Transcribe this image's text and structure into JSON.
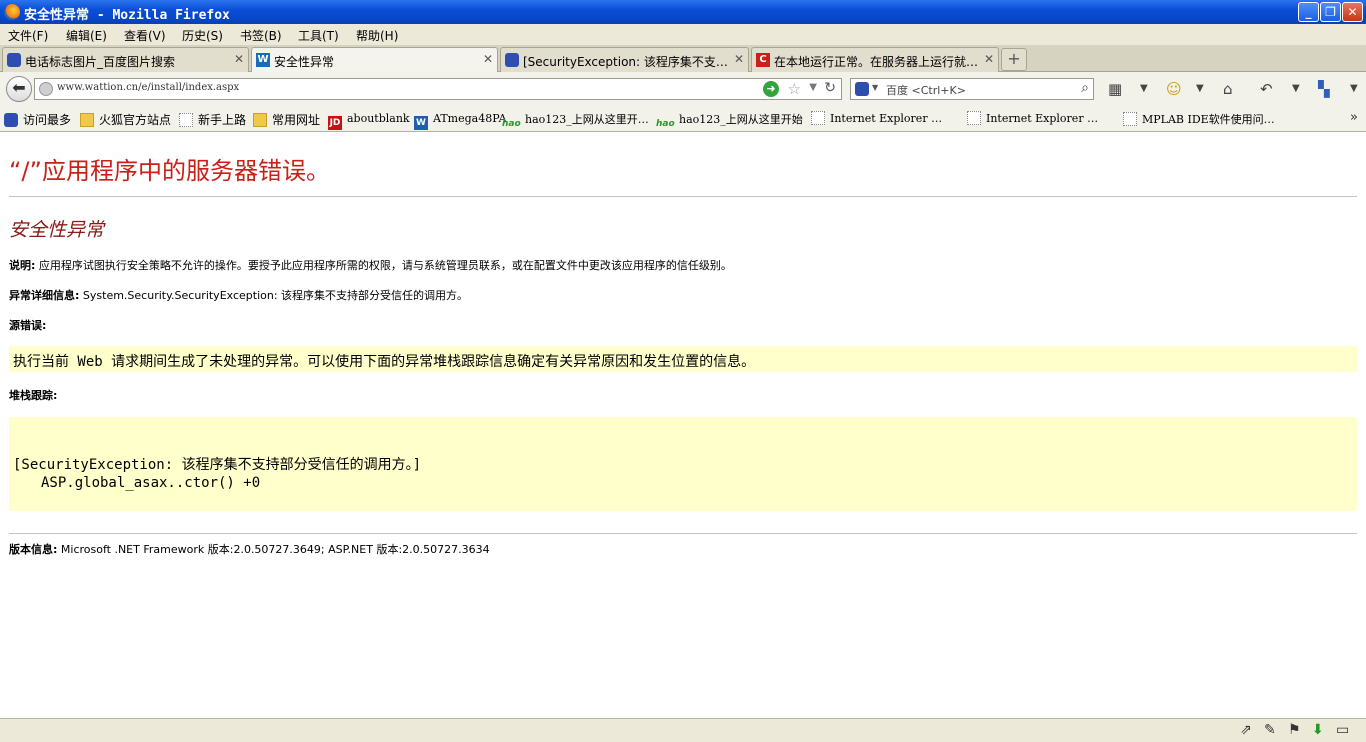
{
  "window": {
    "title": "安全性异常 - Mozilla Firefox",
    "minimize": "_",
    "restore": "❐",
    "close": "✕"
  },
  "menu": [
    {
      "label": "文件(F)"
    },
    {
      "label": "编辑(E)"
    },
    {
      "label": "查看(V)"
    },
    {
      "label": "历史(S)"
    },
    {
      "label": "书签(B)"
    },
    {
      "label": "工具(T)"
    },
    {
      "label": "帮助(H)"
    }
  ],
  "tabs": [
    {
      "label": "电话标志图片_百度图片搜索",
      "icon": "baidu-paw-icon",
      "active": false
    },
    {
      "label": "安全性异常",
      "icon": "w-site-icon",
      "active": true
    },
    {
      "label": "[SecurityException: 该程序集不支…",
      "icon": "baidu-paw-icon",
      "active": false
    },
    {
      "label": "在本地运行正常。在服务器上运行就…",
      "icon": "csdn-icon",
      "active": false
    }
  ],
  "tab_close": "✕",
  "new_tab": "+",
  "nav": {
    "url": "www.wattion.cn/e/install/index.aspx",
    "search_engine": "baidu-paw-icon",
    "search_placeholder": "百度 <Ctrl+K>"
  },
  "bookmarks": [
    {
      "label": "访问最多",
      "icon": "baidu"
    },
    {
      "label": "火狐官方站点",
      "icon": "folder"
    },
    {
      "label": "新手上路",
      "icon": "page"
    },
    {
      "label": "常用网址",
      "icon": "folder"
    },
    {
      "label": "aboutblank",
      "icon": "jd"
    },
    {
      "label": "ATmega48PA",
      "icon": "w"
    },
    {
      "label": "hao123_上网从这里开…",
      "icon": "hao"
    },
    {
      "label": "hao123_上网从这里开始",
      "icon": "hao"
    },
    {
      "label": "Internet Explorer …",
      "icon": "page"
    },
    {
      "label": "Internet Explorer …",
      "icon": "page"
    },
    {
      "label": "MPLAB IDE软件使用问…",
      "icon": "page"
    }
  ],
  "bookmarks_more": "»",
  "page": {
    "heading": "“/”应用程序中的服务器错误。",
    "subheading": "安全性异常",
    "description_label": "说明:",
    "description": "应用程序试图执行安全策略不允许的操作。要授予此应用程序所需的权限，请与系统管理员联系，或在配置文件中更改该应用程序的信任级别。",
    "exception_label": "异常详细信息:",
    "exception": "System.Security.SecurityException: 该程序集不支持部分受信任的调用方。",
    "source_error_label": "源错误:",
    "source_error": "执行当前 Web 请求期间生成了未处理的异常。可以使用下面的异常堆栈跟踪信息确定有关异常原因和发生位置的信息。",
    "stack_trace_label": "堆栈跟踪:",
    "stack_line1": "[SecurityException: 该程序集不支持部分受信任的调用方。]",
    "stack_line2": "ASP.global_asax..ctor() +0",
    "version_label": "版本信息:",
    "version": "Microsoft .NET Framework 版本:2.0.50727.3649; ASP.NET 版本:2.0.50727.3634"
  },
  "colors": {
    "heading": "#c8211a",
    "subheading": "#8a1a15",
    "code_bg": "#ffffcc",
    "titlebar": "#0a4fd6"
  }
}
